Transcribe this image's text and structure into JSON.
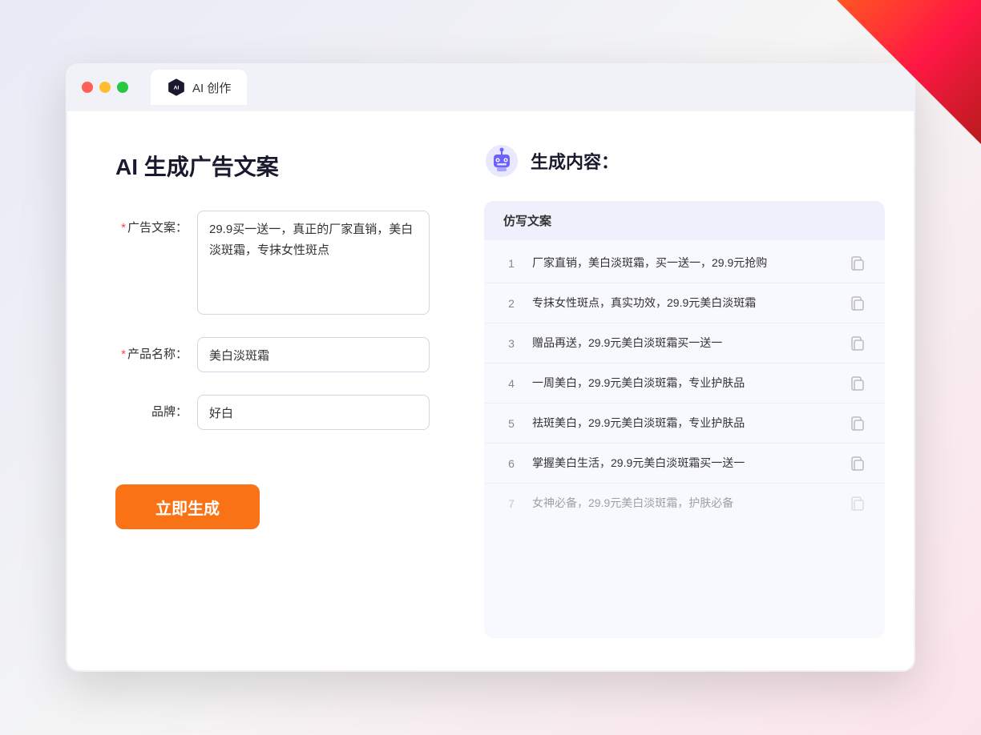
{
  "window": {
    "tab_label": "AI 创作"
  },
  "page": {
    "title": "AI 生成广告文案"
  },
  "form": {
    "ad_copy_label": "广告文案：",
    "ad_copy_required": "*",
    "ad_copy_value": "29.9买一送一，真正的厂家直销，美白淡斑霜，专抹女性斑点",
    "product_name_label": "产品名称：",
    "product_name_required": "*",
    "product_name_value": "美白淡斑霜",
    "brand_label": "品牌：",
    "brand_value": "好白",
    "generate_button": "立即生成"
  },
  "output": {
    "title": "生成内容：",
    "column_header": "仿写文案",
    "results": [
      {
        "num": "1",
        "text": "厂家直销，美白淡斑霜，买一送一，29.9元抢购",
        "dimmed": false
      },
      {
        "num": "2",
        "text": "专抹女性斑点，真实功效，29.9元美白淡斑霜",
        "dimmed": false
      },
      {
        "num": "3",
        "text": "赠品再送，29.9元美白淡斑霜买一送一",
        "dimmed": false
      },
      {
        "num": "4",
        "text": "一周美白，29.9元美白淡斑霜，专业护肤品",
        "dimmed": false
      },
      {
        "num": "5",
        "text": "祛斑美白，29.9元美白淡斑霜，专业护肤品",
        "dimmed": false
      },
      {
        "num": "6",
        "text": "掌握美白生活，29.9元美白淡斑霜买一送一",
        "dimmed": false
      },
      {
        "num": "7",
        "text": "女神必备，29.9元美白淡斑霜，护肤必备",
        "dimmed": true
      }
    ]
  }
}
